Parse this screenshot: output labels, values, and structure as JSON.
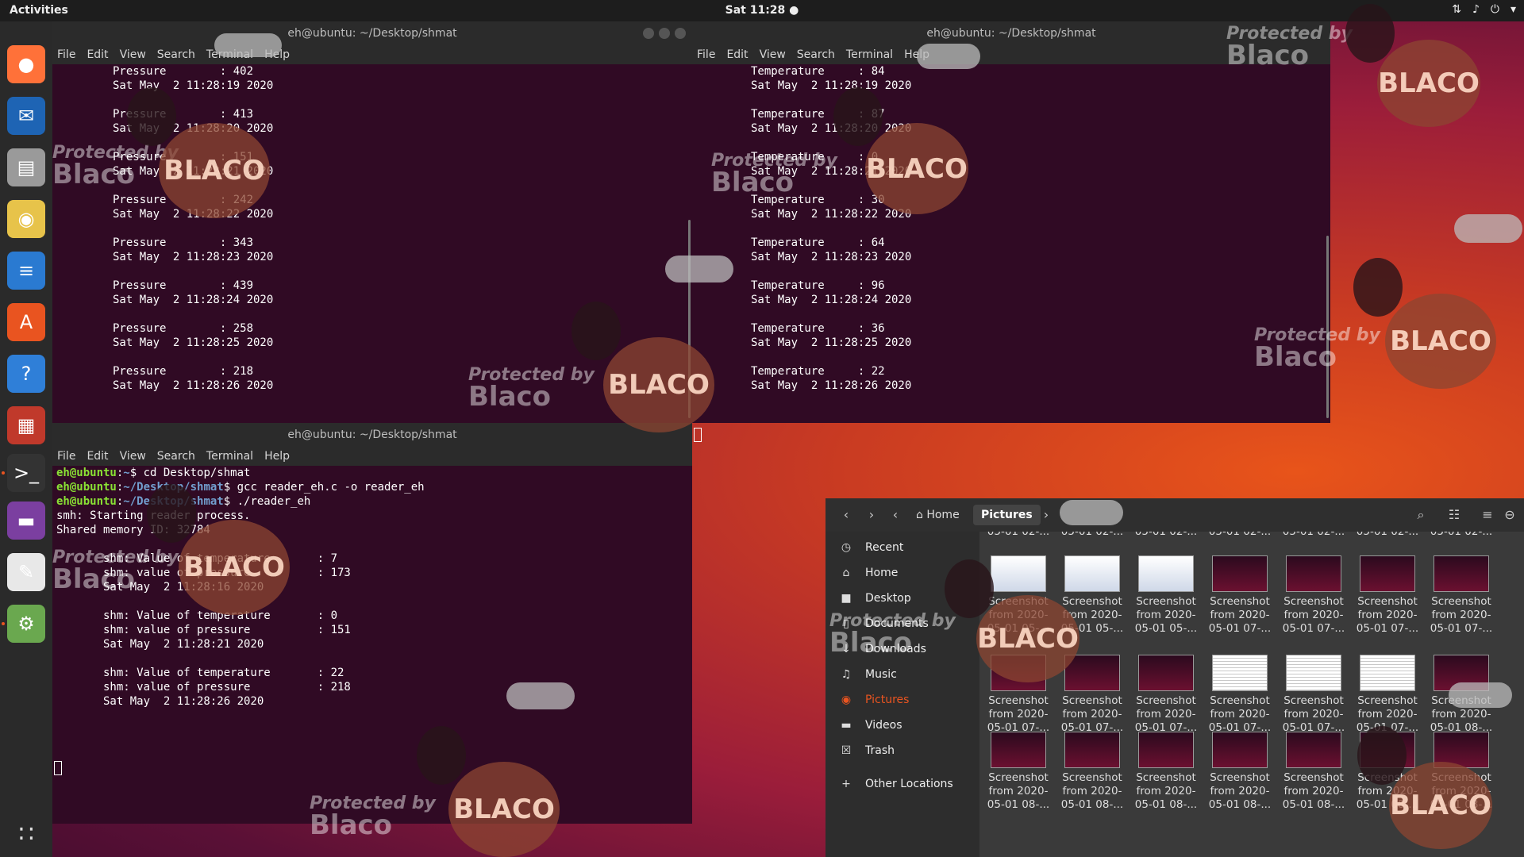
{
  "topbar": {
    "activities": "Activities",
    "clock": "Sat 11:28 ●",
    "tray": [
      "network-icon",
      "volume-icon",
      "power-icon"
    ]
  },
  "dock": {
    "items": [
      {
        "name": "firefox",
        "glyph": "●",
        "color": "#ff7139"
      },
      {
        "name": "thunderbird",
        "glyph": "✉",
        "color": "#1e64b4"
      },
      {
        "name": "files",
        "glyph": "▤",
        "color": "#9a9a9a"
      },
      {
        "name": "rhythmbox",
        "glyph": "◉",
        "color": "#e7c34a"
      },
      {
        "name": "libreoffice-writer",
        "glyph": "≡",
        "color": "#2a7ad1"
      },
      {
        "name": "ubuntu-software",
        "glyph": "A",
        "color": "#e95420"
      },
      {
        "name": "help",
        "glyph": "?",
        "color": "#2f7fd8"
      },
      {
        "name": "app-grid-tiles",
        "glyph": "▦",
        "color": "#c0392b"
      },
      {
        "name": "terminal",
        "glyph": ">_",
        "color": "#333"
      },
      {
        "name": "video-player",
        "glyph": "▬",
        "color": "#7b3fa0"
      },
      {
        "name": "text-editor",
        "glyph": "✎",
        "color": "#e8e8e8"
      },
      {
        "name": "image-viewer",
        "glyph": "⚙",
        "color": "#6aa84f"
      }
    ],
    "show_apps": "∷"
  },
  "terminals": {
    "menu": [
      "File",
      "Edit",
      "View",
      "Search",
      "Terminal",
      "Help"
    ],
    "top_left": {
      "title": "eh@ubuntu: ~/Desktop/shmat",
      "lines": "Pressure        : 402\nSat May  2 11:28:19 2020\n\nPressure        : 413\nSat May  2 11:28:20 2020\n\nPressure        : 151\nSat May  2 11:28:21 2020\n\nPressure        : 242\nSat May  2 11:28:22 2020\n\nPressure        : 343\nSat May  2 11:28:23 2020\n\nPressure        : 439\nSat May  2 11:28:24 2020\n\nPressure        : 258\nSat May  2 11:28:25 2020\n\nPressure        : 218\nSat May  2 11:28:26 2020"
    },
    "top_right": {
      "title": "eh@ubuntu: ~/Desktop/shmat",
      "lines": "Temperature     : 84\nSat May  2 11:28:19 2020\n\nTemperature     : 87\nSat May  2 11:28:20 2020\n\nTemperature     : 0\nSat May  2 11:28:21 2020\n\nTemperature     : 30\nSat May  2 11:28:22 2020\n\nTemperature     : 64\nSat May  2 11:28:23 2020\n\nTemperature     : 96\nSat May  2 11:28:24 2020\n\nTemperature     : 36\nSat May  2 11:28:25 2020\n\nTemperature     : 22\nSat May  2 11:28:26 2020"
    },
    "bottom": {
      "title": "eh@ubuntu: ~/Desktop/shmat",
      "prompt_user": "eh@ubuntu",
      "cmd1_path": "~",
      "cmd1": "$ cd Desktop/shmat",
      "cmd2_path": "~/Desktop/shmat",
      "cmd2": "$ gcc reader_eh.c -o reader_eh",
      "cmd3_path": "~/Desktop/shmat",
      "cmd3": "$ ./reader_eh",
      "output": "smh: Starting reader process.\nShared memory ID: 32784\n\n       shm: Value of temperature       : 7\n       shm: value of pressure          : 173\n       Sat May  2 11:28:16 2020\n\n       shm: Value of temperature       : 0\n       shm: value of pressure          : 151\n       Sat May  2 11:28:21 2020\n\n       shm: Value of temperature       : 22\n       shm: value of pressure          : 218\n       Sat May  2 11:28:26 2020"
    }
  },
  "files": {
    "breadcrumb": [
      "Home",
      "Pictures"
    ],
    "sidebar": [
      {
        "label": "Recent",
        "icon": "clock-icon",
        "glyph": "◷"
      },
      {
        "label": "Home",
        "icon": "home-icon",
        "glyph": "⌂"
      },
      {
        "label": "Desktop",
        "icon": "folder-icon",
        "glyph": "■"
      },
      {
        "label": "Documents",
        "icon": "document-icon",
        "glyph": "▯"
      },
      {
        "label": "Downloads",
        "icon": "download-icon",
        "glyph": "↓"
      },
      {
        "label": "Music",
        "icon": "music-icon",
        "glyph": "♫"
      },
      {
        "label": "Pictures",
        "icon": "camera-icon",
        "glyph": "◉",
        "active": true
      },
      {
        "label": "Videos",
        "icon": "video-icon",
        "glyph": "▬"
      },
      {
        "label": "Trash",
        "icon": "trash-icon",
        "glyph": "☒"
      },
      {
        "label": "Other Locations",
        "icon": "plus-icon",
        "glyph": "+"
      }
    ],
    "top_row_labels": [
      "05-01 02-...",
      "05-01 02-...",
      "05-01 02-...",
      "05-01 02-...",
      "05-01 02-...",
      "05-01 02-...",
      "05-01 02-..."
    ],
    "rows": [
      [
        {
          "l1": "Screenshot",
          "l2": "from 2020-",
          "l3": "05-01 05-...",
          "thumb": "light"
        },
        {
          "l1": "Screenshot",
          "l2": "from 2020-",
          "l3": "05-01 05-...",
          "thumb": "light"
        },
        {
          "l1": "Screenshot",
          "l2": "from 2020-",
          "l3": "05-01 05-...",
          "thumb": "light"
        },
        {
          "l1": "Screenshot",
          "l2": "from 2020-",
          "l3": "05-01 07-...",
          "thumb": "dark"
        },
        {
          "l1": "Screenshot",
          "l2": "from 2020-",
          "l3": "05-01 07-...",
          "thumb": "dark"
        },
        {
          "l1": "Screenshot",
          "l2": "from 2020-",
          "l3": "05-01 07-...",
          "thumb": "dark"
        },
        {
          "l1": "Screenshot",
          "l2": "from 2020-",
          "l3": "05-01 07-...",
          "thumb": "dark"
        }
      ],
      [
        {
          "l1": "Screenshot",
          "l2": "from 2020-",
          "l3": "05-01 07-...",
          "thumb": "dark"
        },
        {
          "l1": "Screenshot",
          "l2": "from 2020-",
          "l3": "05-01 07-...",
          "thumb": "dark"
        },
        {
          "l1": "Screenshot",
          "l2": "from 2020-",
          "l3": "05-01 07-...",
          "thumb": "dark"
        },
        {
          "l1": "Screenshot",
          "l2": "from 2020-",
          "l3": "05-01 07-...",
          "thumb": "code"
        },
        {
          "l1": "Screenshot",
          "l2": "from 2020-",
          "l3": "05-01 07-...",
          "thumb": "code"
        },
        {
          "l1": "Screenshot",
          "l2": "from 2020-",
          "l3": "05-01 07-...",
          "thumb": "code"
        },
        {
          "l1": "Screenshot",
          "l2": "from 2020-",
          "l3": "05-01 08-...",
          "thumb": "dark"
        }
      ],
      [
        {
          "l1": "Screenshot",
          "l2": "from 2020-",
          "l3": "05-01 08-...",
          "thumb": "dark"
        },
        {
          "l1": "Screenshot",
          "l2": "from 2020-",
          "l3": "05-01 08-...",
          "thumb": "dark"
        },
        {
          "l1": "Screenshot",
          "l2": "from 2020-",
          "l3": "05-01 08-...",
          "thumb": "dark"
        },
        {
          "l1": "Screenshot",
          "l2": "from 2020-",
          "l3": "05-01 08-...",
          "thumb": "dark"
        },
        {
          "l1": "Screenshot",
          "l2": "from 2020-",
          "l3": "05-01 08-...",
          "thumb": "dark"
        },
        {
          "l1": "Screenshot",
          "l2": "from 2020-",
          "l3": "05-01 08-...",
          "thumb": "dark"
        },
        {
          "l1": "Screenshot",
          "l2": "from 2020-",
          "l3": "05-01 08-...",
          "thumb": "dark"
        }
      ]
    ]
  },
  "watermark": {
    "line1": "Protected by",
    "line2": "Blaco",
    "sheep_text": "BLACO"
  }
}
